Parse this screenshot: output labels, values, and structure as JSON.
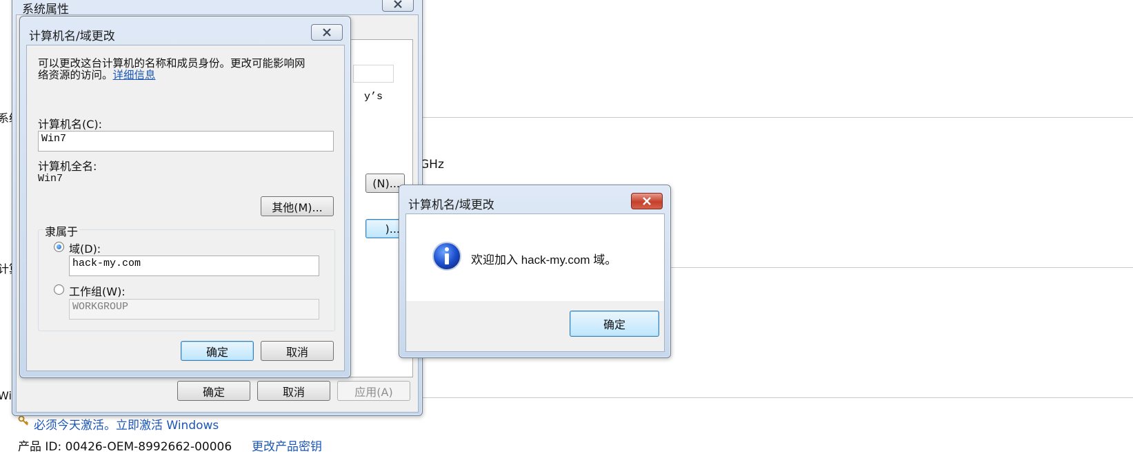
{
  "background": {
    "partial_left_1": "系统",
    "partial_left_2": "计算",
    "partial_left_3": "Wi",
    "cpu_partial": "GHz",
    "activation_notice": "必须今天激活。立即激活 Windows",
    "product_id": "产品 ID: 00426-OEM-8992662-00006",
    "change_key_link": "更改产品密钥"
  },
  "system_properties": {
    "title": "系统属性",
    "partial_text_ys": "y’s",
    "partial_button_n": "(N)...",
    "partial_button_2": ")...",
    "ok_label": "确定",
    "cancel_label": "取消",
    "apply_label": "应用(A)"
  },
  "name_change_dialog": {
    "title": "计算机名/域更改",
    "intro_line1": "可以更改这台计算机的名称和成员身份。更改可能影响网",
    "intro_line2": "络资源的访问。",
    "details_link": "详细信息",
    "computer_name_label": "计算机名(C):",
    "computer_name_value": "Win7",
    "full_name_label": "计算机全名:",
    "full_name_value": "Win7",
    "more_button": "其他(M)...",
    "member_of_label": "隶属于",
    "domain_label": "域(D):",
    "domain_value": "hack-my.com",
    "workgroup_label": "工作组(W):",
    "workgroup_value": "WORKGROUP",
    "ok_label": "确定",
    "cancel_label": "取消"
  },
  "welcome_message": {
    "title": "计算机名/域更改",
    "message": "欢迎加入 hack-my.com 域。",
    "ok_label": "确定",
    "icon": "info-icon"
  }
}
